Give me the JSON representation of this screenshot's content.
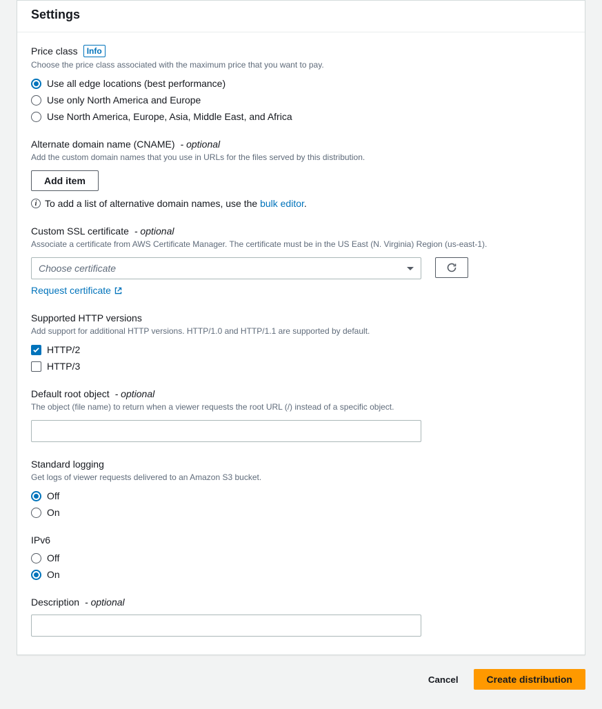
{
  "panel": {
    "title": "Settings"
  },
  "priceClass": {
    "label": "Price class",
    "info": "Info",
    "hint": "Choose the price class associated with the maximum price that you want to pay.",
    "options": [
      "Use all edge locations (best performance)",
      "Use only North America and Europe",
      "Use North America, Europe, Asia, Middle East, and Africa"
    ],
    "selectedIndex": 0
  },
  "cname": {
    "label": "Alternate domain name (CNAME)",
    "optional": "- optional",
    "hint": "Add the custom domain names that you use in URLs for the files served by this distribution.",
    "addButton": "Add item",
    "notePrefix": "To add a list of alternative domain names, use the ",
    "noteLink": "bulk editor",
    "noteSuffix": "."
  },
  "ssl": {
    "label": "Custom SSL certificate",
    "optional": "- optional",
    "hint": "Associate a certificate from AWS Certificate Manager. The certificate must be in the US East (N. Virginia) Region (us-east-1).",
    "placeholder": "Choose certificate",
    "requestLink": "Request certificate"
  },
  "http": {
    "label": "Supported HTTP versions",
    "hint": "Add support for additional HTTP versions. HTTP/1.0 and HTTP/1.1 are supported by default.",
    "options": [
      "HTTP/2",
      "HTTP/3"
    ],
    "checked": [
      true,
      false
    ]
  },
  "rootObject": {
    "label": "Default root object",
    "optional": "- optional",
    "hint": "The object (file name) to return when a viewer requests the root URL (/) instead of a specific object.",
    "value": ""
  },
  "logging": {
    "label": "Standard logging",
    "hint": "Get logs of viewer requests delivered to an Amazon S3 bucket.",
    "options": [
      "Off",
      "On"
    ],
    "selectedIndex": 0
  },
  "ipv6": {
    "label": "IPv6",
    "options": [
      "Off",
      "On"
    ],
    "selectedIndex": 1
  },
  "description": {
    "label": "Description",
    "optional": "- optional",
    "value": ""
  },
  "footer": {
    "cancel": "Cancel",
    "submit": "Create distribution"
  }
}
